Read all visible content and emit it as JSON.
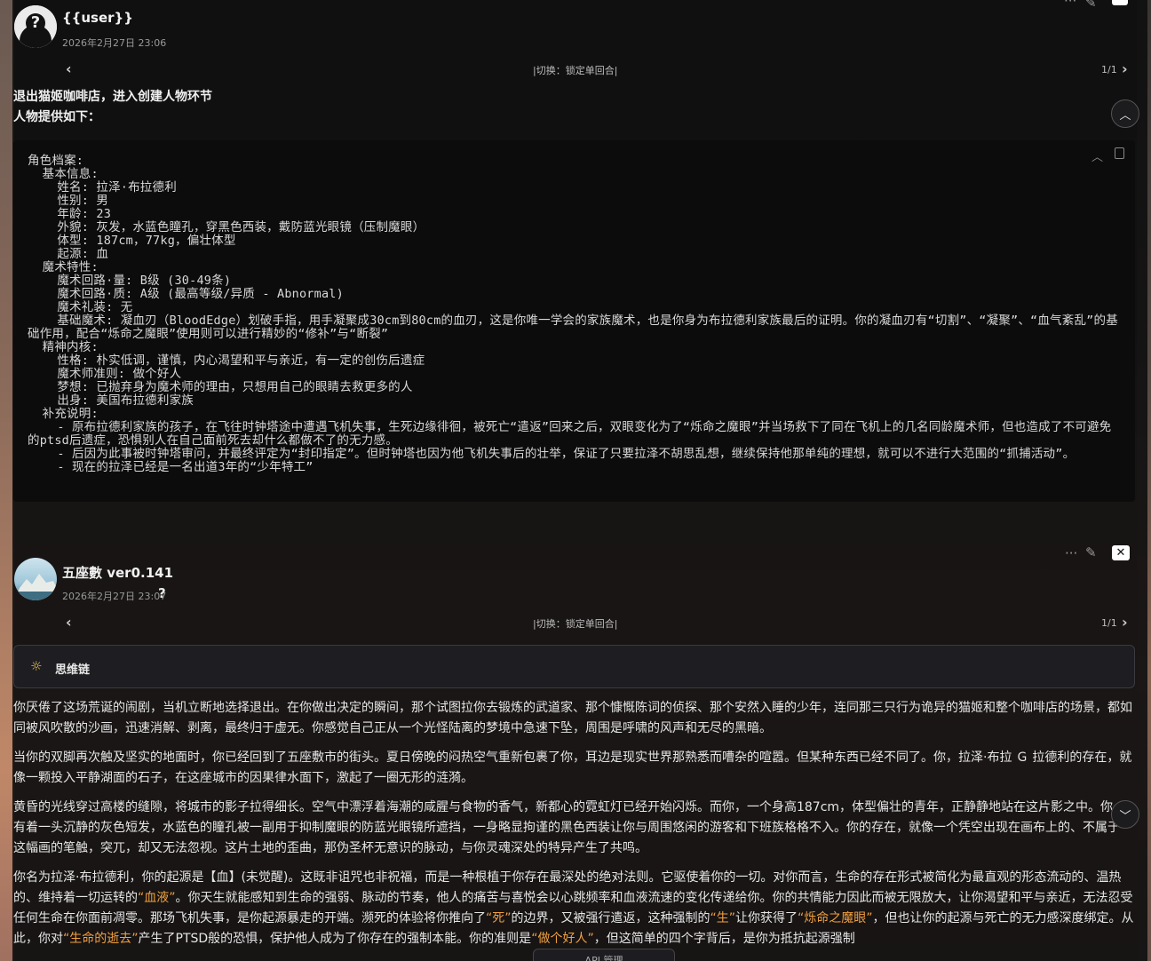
{
  "message1": {
    "name": "{{user}}",
    "timestamp": "2026年2月27日 23:06",
    "swipe_label": "|切换：锁定单回合|",
    "counter": "1/1",
    "intro_line1": "退出猫姬咖啡店，进入创建人物环节",
    "intro_line2": "人物提供如下：",
    "code": "角色档案:\n  基本信息:\n    姓名: 拉泽·布拉德利\n    性别: 男\n    年龄: 23\n    外貌: 灰发，水蓝色瞳孔，穿黑色西装，戴防蓝光眼镜（压制魔眼）\n    体型: 187cm，77kg，偏壮体型\n    起源: 血\n  魔术特性:\n    魔术回路·量: B级 (30-49条)\n    魔术回路·质: A级 (最高等级/异质 - Abnormal)\n    魔术礼装: 无\n    基础魔术: 凝血刃（BloodEdge）划破手指，用手凝聚成30cm到80cm的血刃，这是你唯一学会的家族魔术，也是你身为布拉德利家族最后的证明。你的凝血刃有“切割”、“凝聚”、“血气紊乱”的基础作用，配合“烁命之魔眼”使用则可以进行精妙的“修补”与“断裂”\n  精神内核:\n    性格: 朴实低调，谨慎，内心渴望和平与亲近，有一定的创伤后遗症\n    魔术师准则: 做个好人\n    梦想: 已抛弃身为魔术师的理由，只想用自己的眼睛去救更多的人\n    出身: 美国布拉德利家族\n  补充说明:\n    - 原布拉德利家族的孩子，在飞往时钟塔途中遭遇飞机失事，生死边缘徘徊，被死亡“遣返”回来之后，双眼变化为了“烁命之魔眼”并当场救下了同在飞机上的几名同龄魔术师，但也造成了不可避免的ptsd后遗症，恐惧别人在自己面前死去却什么都做不了的无力感。\n    - 后因为此事被时钟塔审问，并最终评定为“封印指定”。但时钟塔也因为他飞机失事后的壮举，保证了只要拉泽不胡思乱想，继续保持他那单纯的理想，就可以不进行大范围的“抓捕活动”。\n    - 现在的拉泽已经是一名出道3年的“少年特工”"
  },
  "message2": {
    "name": "五座數 ver0.141",
    "timestamp": "2026年2月27日 23:07",
    "help_icon": "?",
    "swipe_label": "|切换：锁定单回合|",
    "counter": "1/1",
    "thinking_label": "思维链",
    "p1": "你厌倦了这场荒诞的闹剧，当机立断地选择退出。在你做出决定的瞬间，那个试图拉你去锻炼的武道家、那个慷慨陈词的侦探、那个安然入睡的少年，连同那三只行为诡异的猫姬和整个咖啡店的场景，都如同被风吹散的沙画，迅速消解、剥离，最终归于虚无。你感觉自己正从一个光怪陆离的梦境中急速下坠，周围是呼啸的风声和无尽的黑暗。",
    "p2": "当你的双脚再次触及坚实的地面时，你已经回到了五座敷市的街头。夏日傍晚的闷热空气重新包裹了你，耳边是现实世界那熟悉而嘈杂的喧嚣。但某种东西已经不同了。你，拉泽·布拉 Ｇ 拉德利的存在，就像一颗投入平静湖面的石子，在这座城市的因果律水面下，激起了一圈无形的涟漪。",
    "p3": "黄昏的光线穿过高楼的缝隙，将城市的影子拉得细长。空气中漂浮着海潮的咸腥与食物的香气，新都心的霓虹灯已经开始闪烁。而你，一个身高187cm，体型偏壮的青年，正静静地站在这片影之中。你有着一头沉静的灰色短发，水蓝色的瞳孔被一副用于抑制魔眼的防蓝光眼镜所遮挡，一身略显拘谨的黑色西装让你与周围悠闲的游客和下班族格格不入。你的存在，就像一个凭空出现在画布上的、不属于这幅画的笔触，突兀，却又无法忽视。这片土地的歪曲，那伪圣杯无意识的脉动，与你灵魂深处的特异产生了共鸣。",
    "p4a": "你名为拉泽·布拉德利，你的起源是【血】(未觉醒)。这既非诅咒也非祝福，而是一种根植于你存在最深处的绝对法则。它驱使着你的一切。对你而言，生命的存在形式被简化为最直观的形态流动的、温热的、维持着一切运转的",
    "hl1": "“血液”",
    "p4b": "。你天生就能感知到生命的强弱、脉动的节奏，他人的痛苦与喜悦会以心跳频率和血液流速的变化传递给你。你的共情能力因此而被无限放大，让你渴望和平与亲近，无法忍受任何生命在你面前凋零。那场飞机失事，是你起源暴走的开端。濒死的体验将你推向了",
    "hl2": "“死”",
    "p4c": "的边界，又被强行遣返，这种强制的",
    "hl3": "“生”",
    "p4d": "让你获得了",
    "hl4": "“烁命之魔眼”",
    "p4e": "，但也让你的起源与死亡的无力感深度绑定。从此，你对",
    "hl5": "“生命的逝去”",
    "p4f": "产生了PTSD般的恐惧，保护他人成为了你存在的强制本能。你的准则是",
    "hl6": "“做个好人”",
    "p4g": "，但这简单的四个字背后，是你为抵抗起源强制"
  },
  "api_tab": "API 管理",
  "colors": {
    "highlight": "#f0a040",
    "panel": "#0c0c0c"
  }
}
